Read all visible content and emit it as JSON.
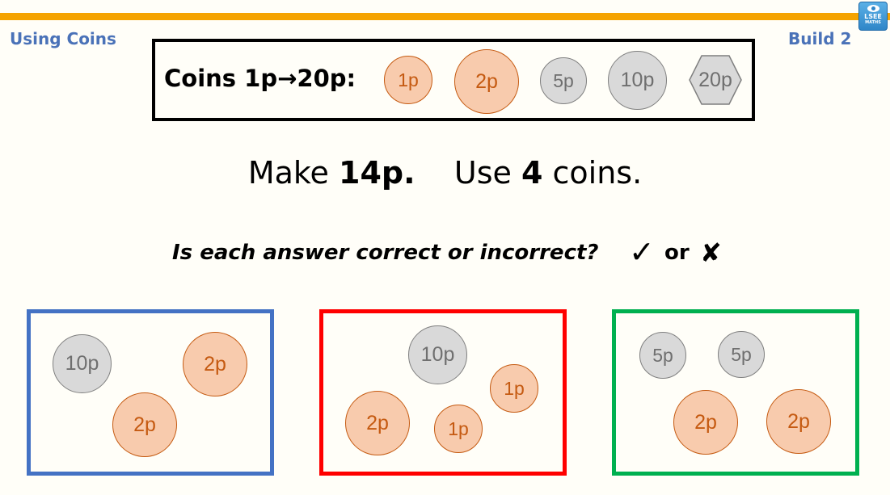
{
  "header": {
    "topic": "Using Coins",
    "build": "Build 2",
    "logo": {
      "line1": "LSEE",
      "line2": "MATHS",
      "icon": "eye-icon"
    },
    "accent_color": "#f5a300",
    "title_color": "#4a72b8"
  },
  "coin_key": {
    "label": "Coins 1p→20p:",
    "coins": [
      {
        "label": "1p",
        "type": "copper"
      },
      {
        "label": "2p",
        "type": "copper"
      },
      {
        "label": "5p",
        "type": "silver"
      },
      {
        "label": "10p",
        "type": "silver"
      },
      {
        "label": "20p",
        "type": "silver-hexagon"
      }
    ]
  },
  "task": {
    "make_prefix": "Make",
    "amount": "14p.",
    "use_prefix": "Use",
    "count": "4",
    "count_suffix": "coins."
  },
  "question": {
    "text": "Is each answer correct or incorrect?",
    "tick": "✓",
    "or": "or",
    "cross": "✘"
  },
  "answers": [
    {
      "border_color": "#4472c4",
      "coins": [
        "10p",
        "2p",
        "2p"
      ]
    },
    {
      "border_color": "#ff0000",
      "coins": [
        "10p",
        "1p",
        "2p",
        "1p"
      ]
    },
    {
      "border_color": "#00b050",
      "coins": [
        "5p",
        "5p",
        "2p",
        "2p"
      ]
    }
  ]
}
